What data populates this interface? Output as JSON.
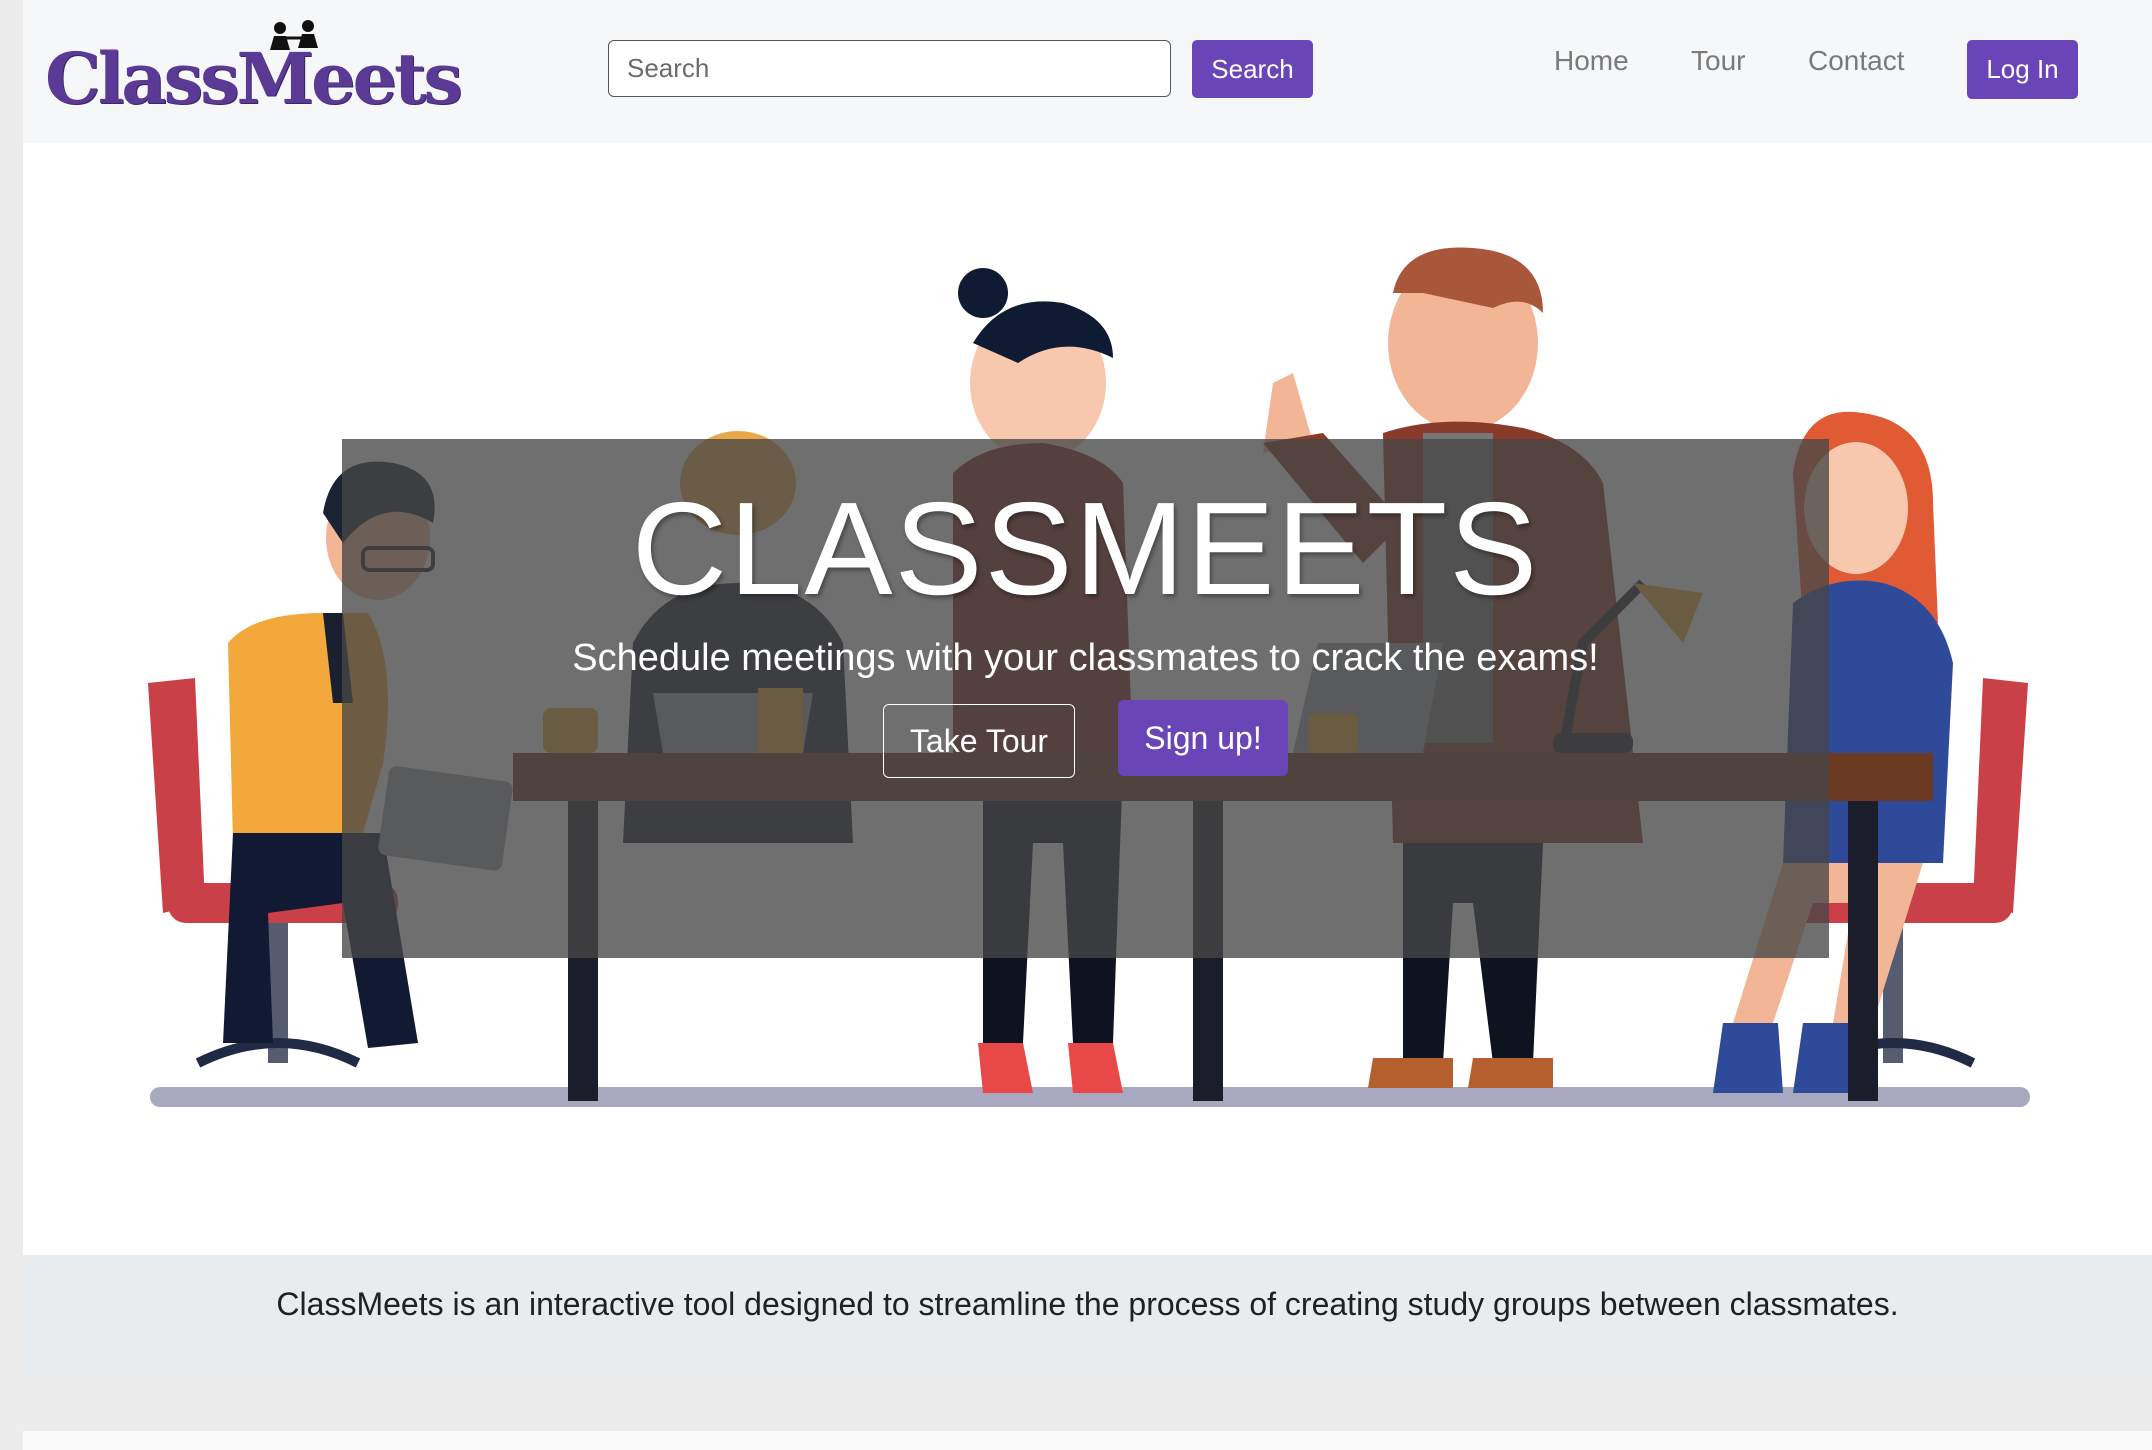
{
  "navbar": {
    "logo_text": "ClassMeets",
    "search_placeholder": "Search",
    "search_button": "Search",
    "links": [
      "Home",
      "Tour",
      "Contact"
    ],
    "login_button": "Log In"
  },
  "hero": {
    "title": "CLASSMEETS",
    "subtitle": "Schedule meetings with your classmates to crack the exams!",
    "tour_button": "Take Tour",
    "signup_button": "Sign up!"
  },
  "about": {
    "text": "ClassMeets is an interactive tool designed to streamline the process of creating study groups between classmates."
  },
  "colors": {
    "brand_purple": "#6a45b8",
    "logo_purple": "#5b3a96",
    "navbar_bg": "#f6f7f9",
    "about_bg": "#e9ecef"
  },
  "icons": [
    "people-logo-icon"
  ]
}
